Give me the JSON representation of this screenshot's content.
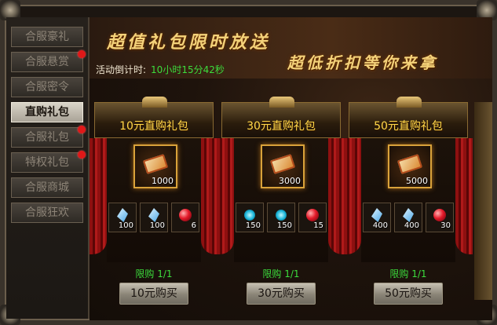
{
  "sidebar": {
    "items": [
      {
        "label": "合服豪礼",
        "active": false,
        "dot": false
      },
      {
        "label": "合服悬赏",
        "active": false,
        "dot": true
      },
      {
        "label": "合服密令",
        "active": false,
        "dot": false
      },
      {
        "label": "直购礼包",
        "active": true,
        "dot": false
      },
      {
        "label": "合服礼包",
        "active": false,
        "dot": true
      },
      {
        "label": "特权礼包",
        "active": false,
        "dot": true
      },
      {
        "label": "合服商城",
        "active": false,
        "dot": false
      },
      {
        "label": "合服狂欢",
        "active": false,
        "dot": false
      }
    ]
  },
  "banner": {
    "title_line1": "超值礼包限时放送",
    "title_line2": "超低折扣等你来拿",
    "countdown_label": "活动倒计时:",
    "countdown_value": "10小时15分42秒"
  },
  "packs": [
    {
      "title": "10元直购礼包",
      "main_item": {
        "icon": "gold-ticket-icon",
        "qty": "1000"
      },
      "sub_items": [
        {
          "icon": "blue-crystal-icon",
          "qty": "100"
        },
        {
          "icon": "blue-crystal-icon",
          "qty": "100"
        },
        {
          "icon": "red-orb-icon",
          "qty": "6"
        }
      ],
      "limit": "限购 1/1",
      "button": "10元购买"
    },
    {
      "title": "30元直购礼包",
      "main_item": {
        "icon": "gold-ticket-icon",
        "qty": "3000"
      },
      "sub_items": [
        {
          "icon": "teal-orb-icon",
          "qty": "150"
        },
        {
          "icon": "teal-orb-icon",
          "qty": "150"
        },
        {
          "icon": "red-orb-icon",
          "qty": "15"
        }
      ],
      "limit": "限购 1/1",
      "button": "30元购买"
    },
    {
      "title": "50元直购礼包",
      "main_item": {
        "icon": "gold-ticket-icon",
        "qty": "5000"
      },
      "sub_items": [
        {
          "icon": "blue-crystal-icon",
          "qty": "400"
        },
        {
          "icon": "blue-crystal-icon",
          "qty": "400"
        },
        {
          "icon": "red-orb-icon",
          "qty": "30"
        }
      ],
      "limit": "限购 1/1",
      "button": "50元购买"
    }
  ],
  "colors": {
    "accent_gold": "#ffd84a",
    "limit_green": "#3cdc3c",
    "notice_red": "#e01818"
  }
}
